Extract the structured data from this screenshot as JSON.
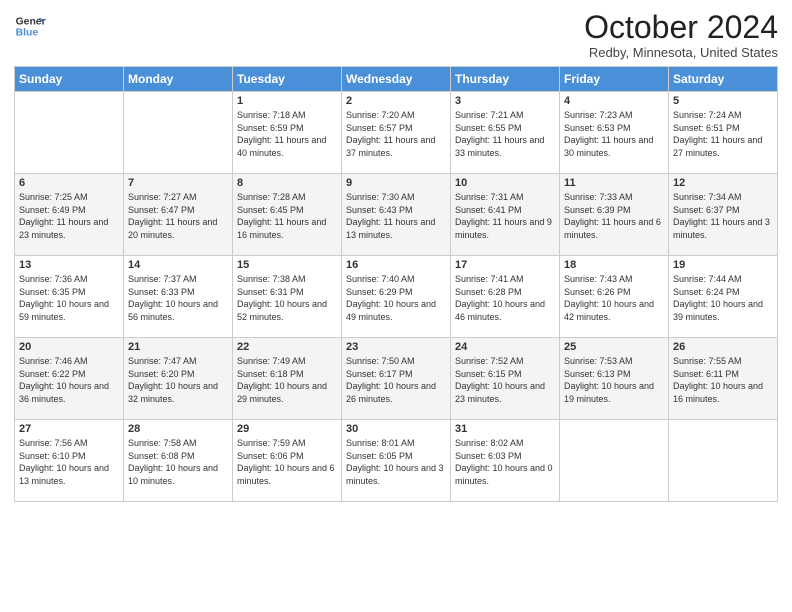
{
  "header": {
    "logo_line1": "General",
    "logo_line2": "Blue",
    "month": "October 2024",
    "location": "Redby, Minnesota, United States"
  },
  "days_of_week": [
    "Sunday",
    "Monday",
    "Tuesday",
    "Wednesday",
    "Thursday",
    "Friday",
    "Saturday"
  ],
  "weeks": [
    [
      {
        "day": "",
        "sunrise": "",
        "sunset": "",
        "daylight": ""
      },
      {
        "day": "",
        "sunrise": "",
        "sunset": "",
        "daylight": ""
      },
      {
        "day": "1",
        "sunrise": "Sunrise: 7:18 AM",
        "sunset": "Sunset: 6:59 PM",
        "daylight": "Daylight: 11 hours and 40 minutes."
      },
      {
        "day": "2",
        "sunrise": "Sunrise: 7:20 AM",
        "sunset": "Sunset: 6:57 PM",
        "daylight": "Daylight: 11 hours and 37 minutes."
      },
      {
        "day": "3",
        "sunrise": "Sunrise: 7:21 AM",
        "sunset": "Sunset: 6:55 PM",
        "daylight": "Daylight: 11 hours and 33 minutes."
      },
      {
        "day": "4",
        "sunrise": "Sunrise: 7:23 AM",
        "sunset": "Sunset: 6:53 PM",
        "daylight": "Daylight: 11 hours and 30 minutes."
      },
      {
        "day": "5",
        "sunrise": "Sunrise: 7:24 AM",
        "sunset": "Sunset: 6:51 PM",
        "daylight": "Daylight: 11 hours and 27 minutes."
      }
    ],
    [
      {
        "day": "6",
        "sunrise": "Sunrise: 7:25 AM",
        "sunset": "Sunset: 6:49 PM",
        "daylight": "Daylight: 11 hours and 23 minutes."
      },
      {
        "day": "7",
        "sunrise": "Sunrise: 7:27 AM",
        "sunset": "Sunset: 6:47 PM",
        "daylight": "Daylight: 11 hours and 20 minutes."
      },
      {
        "day": "8",
        "sunrise": "Sunrise: 7:28 AM",
        "sunset": "Sunset: 6:45 PM",
        "daylight": "Daylight: 11 hours and 16 minutes."
      },
      {
        "day": "9",
        "sunrise": "Sunrise: 7:30 AM",
        "sunset": "Sunset: 6:43 PM",
        "daylight": "Daylight: 11 hours and 13 minutes."
      },
      {
        "day": "10",
        "sunrise": "Sunrise: 7:31 AM",
        "sunset": "Sunset: 6:41 PM",
        "daylight": "Daylight: 11 hours and 9 minutes."
      },
      {
        "day": "11",
        "sunrise": "Sunrise: 7:33 AM",
        "sunset": "Sunset: 6:39 PM",
        "daylight": "Daylight: 11 hours and 6 minutes."
      },
      {
        "day": "12",
        "sunrise": "Sunrise: 7:34 AM",
        "sunset": "Sunset: 6:37 PM",
        "daylight": "Daylight: 11 hours and 3 minutes."
      }
    ],
    [
      {
        "day": "13",
        "sunrise": "Sunrise: 7:36 AM",
        "sunset": "Sunset: 6:35 PM",
        "daylight": "Daylight: 10 hours and 59 minutes."
      },
      {
        "day": "14",
        "sunrise": "Sunrise: 7:37 AM",
        "sunset": "Sunset: 6:33 PM",
        "daylight": "Daylight: 10 hours and 56 minutes."
      },
      {
        "day": "15",
        "sunrise": "Sunrise: 7:38 AM",
        "sunset": "Sunset: 6:31 PM",
        "daylight": "Daylight: 10 hours and 52 minutes."
      },
      {
        "day": "16",
        "sunrise": "Sunrise: 7:40 AM",
        "sunset": "Sunset: 6:29 PM",
        "daylight": "Daylight: 10 hours and 49 minutes."
      },
      {
        "day": "17",
        "sunrise": "Sunrise: 7:41 AM",
        "sunset": "Sunset: 6:28 PM",
        "daylight": "Daylight: 10 hours and 46 minutes."
      },
      {
        "day": "18",
        "sunrise": "Sunrise: 7:43 AM",
        "sunset": "Sunset: 6:26 PM",
        "daylight": "Daylight: 10 hours and 42 minutes."
      },
      {
        "day": "19",
        "sunrise": "Sunrise: 7:44 AM",
        "sunset": "Sunset: 6:24 PM",
        "daylight": "Daylight: 10 hours and 39 minutes."
      }
    ],
    [
      {
        "day": "20",
        "sunrise": "Sunrise: 7:46 AM",
        "sunset": "Sunset: 6:22 PM",
        "daylight": "Daylight: 10 hours and 36 minutes."
      },
      {
        "day": "21",
        "sunrise": "Sunrise: 7:47 AM",
        "sunset": "Sunset: 6:20 PM",
        "daylight": "Daylight: 10 hours and 32 minutes."
      },
      {
        "day": "22",
        "sunrise": "Sunrise: 7:49 AM",
        "sunset": "Sunset: 6:18 PM",
        "daylight": "Daylight: 10 hours and 29 minutes."
      },
      {
        "day": "23",
        "sunrise": "Sunrise: 7:50 AM",
        "sunset": "Sunset: 6:17 PM",
        "daylight": "Daylight: 10 hours and 26 minutes."
      },
      {
        "day": "24",
        "sunrise": "Sunrise: 7:52 AM",
        "sunset": "Sunset: 6:15 PM",
        "daylight": "Daylight: 10 hours and 23 minutes."
      },
      {
        "day": "25",
        "sunrise": "Sunrise: 7:53 AM",
        "sunset": "Sunset: 6:13 PM",
        "daylight": "Daylight: 10 hours and 19 minutes."
      },
      {
        "day": "26",
        "sunrise": "Sunrise: 7:55 AM",
        "sunset": "Sunset: 6:11 PM",
        "daylight": "Daylight: 10 hours and 16 minutes."
      }
    ],
    [
      {
        "day": "27",
        "sunrise": "Sunrise: 7:56 AM",
        "sunset": "Sunset: 6:10 PM",
        "daylight": "Daylight: 10 hours and 13 minutes."
      },
      {
        "day": "28",
        "sunrise": "Sunrise: 7:58 AM",
        "sunset": "Sunset: 6:08 PM",
        "daylight": "Daylight: 10 hours and 10 minutes."
      },
      {
        "day": "29",
        "sunrise": "Sunrise: 7:59 AM",
        "sunset": "Sunset: 6:06 PM",
        "daylight": "Daylight: 10 hours and 6 minutes."
      },
      {
        "day": "30",
        "sunrise": "Sunrise: 8:01 AM",
        "sunset": "Sunset: 6:05 PM",
        "daylight": "Daylight: 10 hours and 3 minutes."
      },
      {
        "day": "31",
        "sunrise": "Sunrise: 8:02 AM",
        "sunset": "Sunset: 6:03 PM",
        "daylight": "Daylight: 10 hours and 0 minutes."
      },
      {
        "day": "",
        "sunrise": "",
        "sunset": "",
        "daylight": ""
      },
      {
        "day": "",
        "sunrise": "",
        "sunset": "",
        "daylight": ""
      }
    ]
  ]
}
